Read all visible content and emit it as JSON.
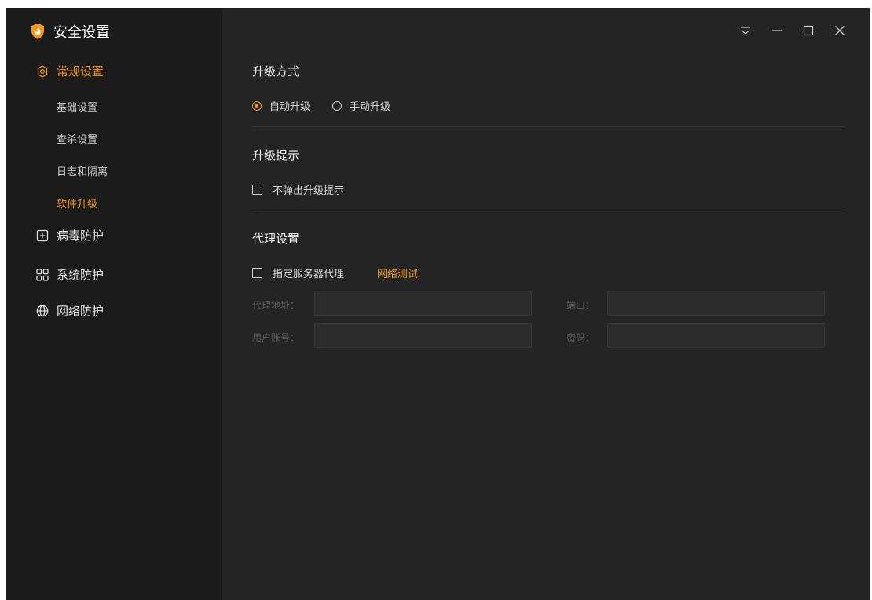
{
  "app": {
    "title": "安全设置",
    "accent": "#f29a1f"
  },
  "sidebar": {
    "items": [
      {
        "label": "常规设置",
        "icon": "gear-icon",
        "active": true
      },
      {
        "label": "病毒防护",
        "icon": "plus-square-icon",
        "active": false
      },
      {
        "label": "系统防护",
        "icon": "grid-icon",
        "active": false
      },
      {
        "label": "网络防护",
        "icon": "globe-icon",
        "active": false
      }
    ],
    "subitems": [
      {
        "label": "基础设置",
        "active": false
      },
      {
        "label": "查杀设置",
        "active": false
      },
      {
        "label": "日志和隔离",
        "active": false
      },
      {
        "label": "软件升级",
        "active": true
      }
    ]
  },
  "window_controls": [
    "menu-icon",
    "minimize-icon",
    "maximize-icon",
    "close-icon"
  ],
  "upgrade_mode": {
    "title": "升级方式",
    "options": [
      {
        "label": "自动升级",
        "checked": true
      },
      {
        "label": "手动升级",
        "checked": false
      }
    ]
  },
  "upgrade_tip": {
    "title": "升级提示",
    "checkbox_label": "不弹出升级提示",
    "checked": false
  },
  "proxy": {
    "title": "代理设置",
    "checkbox_label": "指定服务器代理",
    "checked": false,
    "test_link": "网络测试",
    "address_label": "代理地址：",
    "address_value": "",
    "port_label": "端口：",
    "port_value": "",
    "account_label": "用户账号：",
    "account_value": "",
    "password_label": "密码：",
    "password_value": ""
  }
}
